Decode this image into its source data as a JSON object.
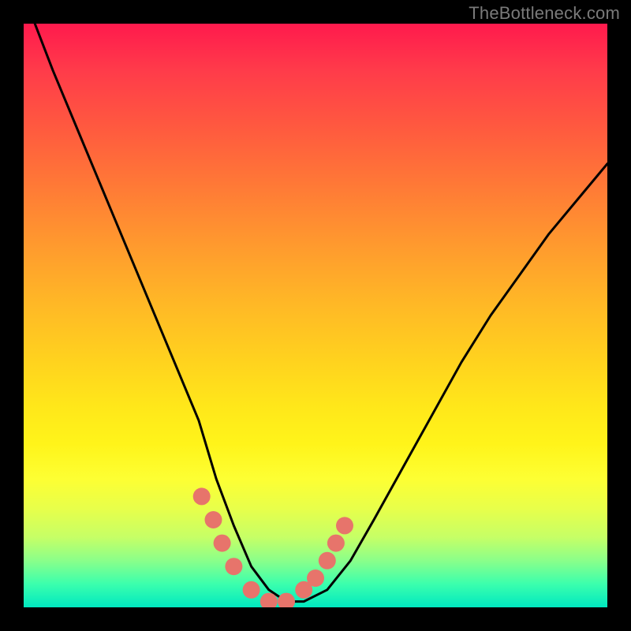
{
  "watermark": "TheBottleneck.com",
  "chart_data": {
    "type": "line",
    "title": "",
    "xlabel": "",
    "ylabel": "",
    "xlim": [
      0,
      100
    ],
    "ylim": [
      0,
      100
    ],
    "series": [
      {
        "name": "bottleneck-curve",
        "x": [
          0,
          5,
          10,
          15,
          20,
          25,
          30,
          33,
          36,
          39,
          42,
          45,
          48,
          52,
          56,
          60,
          65,
          70,
          75,
          80,
          85,
          90,
          95,
          100
        ],
        "values": [
          105,
          92,
          80,
          68,
          56,
          44,
          32,
          22,
          14,
          7,
          3,
          1,
          1,
          3,
          8,
          15,
          24,
          33,
          42,
          50,
          57,
          64,
          70,
          76
        ]
      }
    ],
    "markers": {
      "name": "highlight-dots",
      "color": "#e7746b",
      "x": [
        30.5,
        32.5,
        34,
        36,
        39,
        42,
        45,
        48,
        50,
        52,
        53.5,
        55
      ],
      "values": [
        19,
        15,
        11,
        7,
        3,
        1,
        1,
        3,
        5,
        8,
        11,
        14
      ]
    }
  }
}
